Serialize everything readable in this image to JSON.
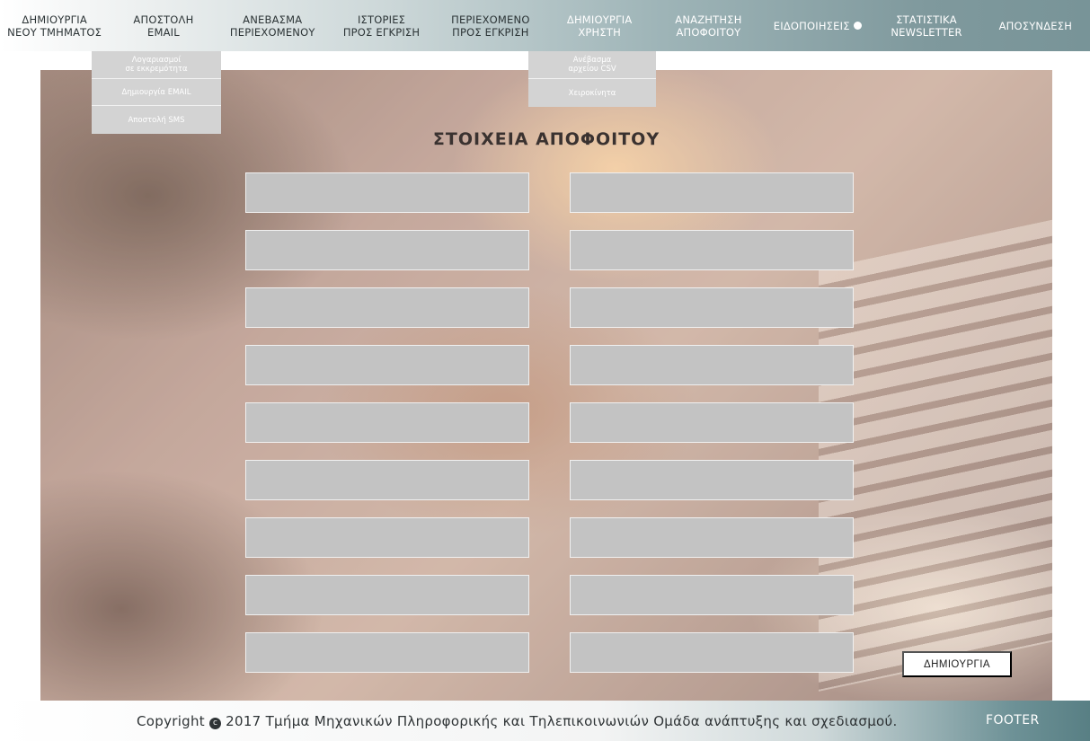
{
  "nav": {
    "items": [
      {
        "label": "ΔΗΜΙΟΥΡΓΙΑ\nΝΕΟΥ ΤΜΗΜΑΤΟΣ"
      },
      {
        "label": "ΑΠΟΣΤΟΛΗ\nEMAIL"
      },
      {
        "label": "ΑΝΕΒΑΣΜΑ\nΠΕΡΙΕΧΟΜΕΝΟΥ"
      },
      {
        "label": "ΙΣΤΟΡΙΕΣ\nΠΡΟΣ ΕΓΚΡΙΣΗ"
      },
      {
        "label": "ΠΕΡΙΕΧΟΜΕΝΟ\nΠΡΟΣ ΕΓΚΡΙΣΗ"
      },
      {
        "label": "ΔΗΜΙΟΥΡΓΙΑ\nΧΡΗΣΤΗ"
      },
      {
        "label": "ΑΝΑΖΗΤΗΣΗ\nΑΠΟΦΟΙΤΟΥ"
      },
      {
        "label": "ΕΙΔΟΠΟΙΗΣΕΙΣ"
      },
      {
        "label": "ΣΤΑΤΙΣΤΙΚΑ\nNEWSLETTER"
      },
      {
        "label": "ΑΠΟΣΥΝΔΕΣΗ"
      }
    ]
  },
  "email_dropdown": {
    "items": [
      {
        "label": "Λογαριασμοί\nσε εκκρεμότητα"
      },
      {
        "label": "Δημιουργία EMAIL"
      },
      {
        "label": "Αποστολή SMS"
      }
    ]
  },
  "user_dropdown": {
    "items": [
      {
        "label": "Ανέβασμα\nαρχείου CSV"
      },
      {
        "label": "Χειροκίνητα"
      }
    ]
  },
  "form": {
    "title": "ΣΤΟΙΧΕΙΑ ΑΠΟΦΟΙΤΟΥ",
    "submit_label": "ΔΗΜΙΟΥΡΓΙΑ"
  },
  "footer": {
    "copyright_prefix": "Copyright",
    "copyright_text": "2017 Τμήμα Μηχανικών Πληροφορικής και Τηλεπικοινωνιών Ομάδα ανάπτυξης και σχεδιασμού.",
    "label": "FOOTER"
  },
  "colors": {
    "field_bg": "#c3c3c3",
    "nav_accent": "#789498",
    "footer_accent": "#587f84"
  }
}
